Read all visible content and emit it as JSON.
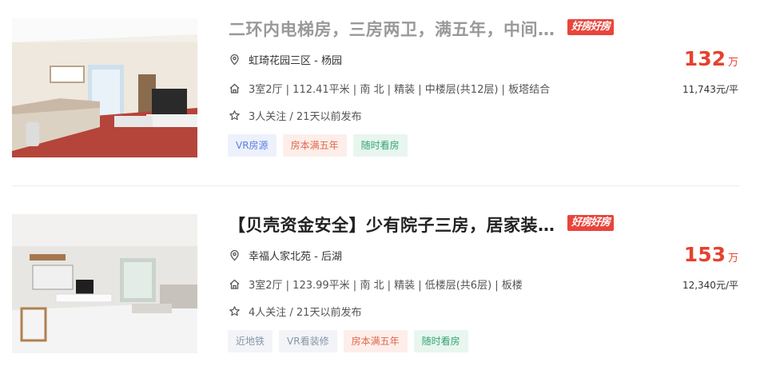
{
  "colors": {
    "price": "#e5412f",
    "badge": "#e8453c",
    "tag_blue": "#5b7ee0",
    "tag_red": "#e0684a",
    "tag_green": "#35a373",
    "tag_gray": "#8895a8"
  },
  "listings": [
    {
      "title": "二环内电梯房，三房两卫，满五年，中间楼层",
      "badge": "好房好房",
      "location": "虹琦花园三区 - 杨园",
      "info": "3室2厅 | 112.41平米 | 南 北 | 精装 | 中楼层(共12层) | 板塔结合",
      "follow": "3人关注 / 21天以前发布",
      "price": "132",
      "price_unit": "万",
      "unit_price": "11,743元/平",
      "tags": [
        "VR房源",
        "房本满五年",
        "随时看房"
      ],
      "tag_colors": [
        "blue",
        "red",
        "green"
      ]
    },
    {
      "title": "【贝壳资金安全】少有院子三房，居家装修，满五年",
      "badge": "好房好房",
      "location": "幸福人家北苑 - 后湖",
      "info": "3室2厅 | 123.99平米 | 南 北 | 精装 | 低楼层(共6层) | 板楼",
      "follow": "4人关注 / 21天以前发布",
      "price": "153",
      "price_unit": "万",
      "unit_price": "12,340元/平",
      "tags": [
        "近地铁",
        "VR看装修",
        "房本满五年",
        "随时看房"
      ],
      "tag_colors": [
        "gray",
        "gray",
        "red",
        "green"
      ]
    }
  ],
  "icons": {
    "location": "map-pin-icon",
    "house": "house-icon",
    "follow": "star-icon"
  }
}
